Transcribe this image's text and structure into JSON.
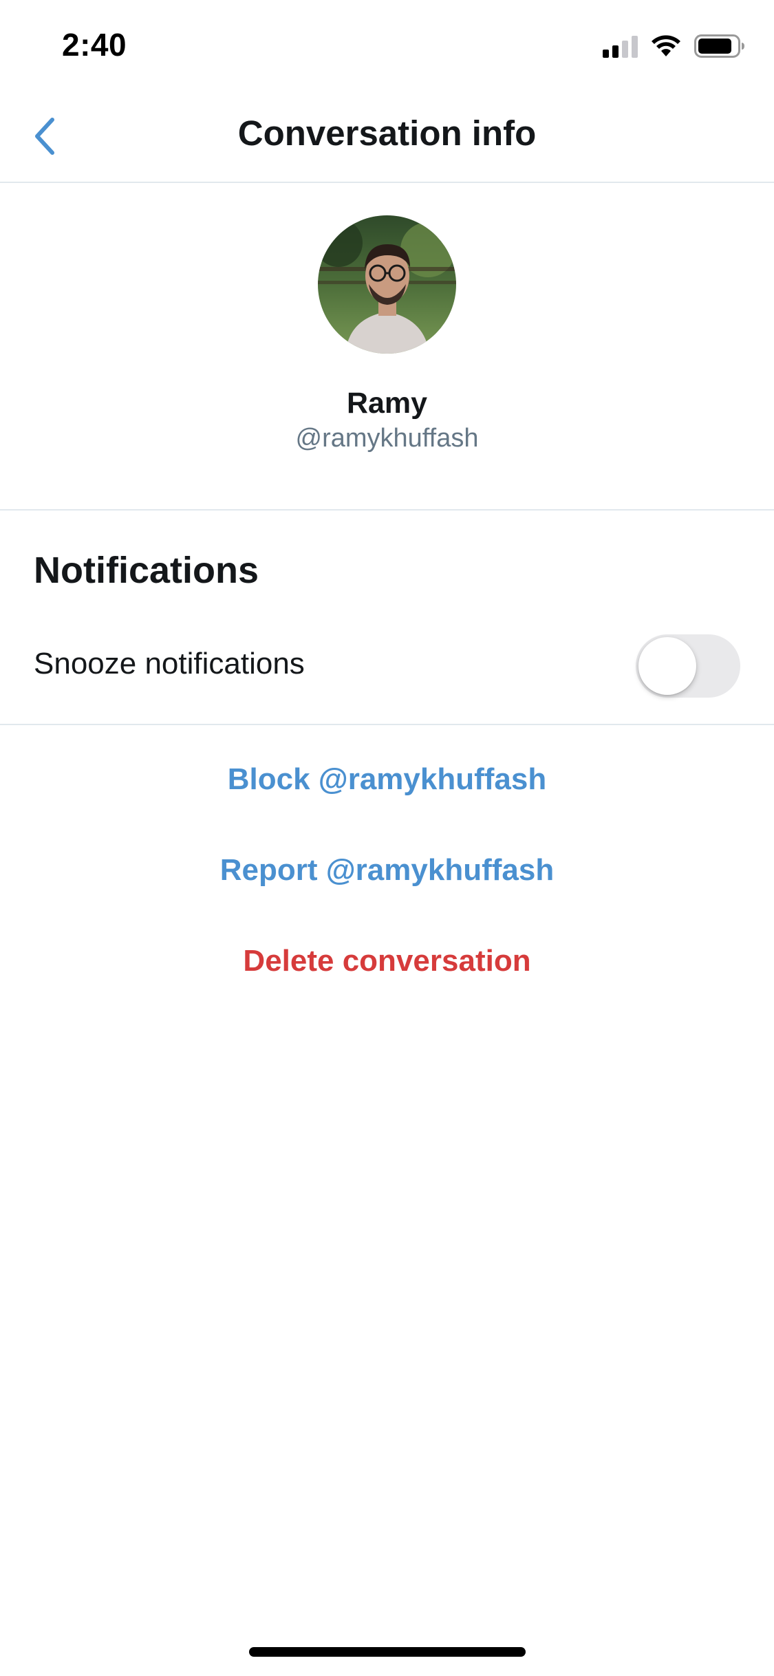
{
  "status_bar": {
    "time": "2:40",
    "icons": [
      "signal-icon",
      "wifi-icon",
      "battery-icon"
    ]
  },
  "nav": {
    "back_icon": "chevron-left-icon",
    "title": "Conversation info"
  },
  "profile": {
    "avatar": "avatar-photo",
    "name": "Ramy",
    "handle": "@ramykhuffash"
  },
  "notifications": {
    "heading": "Notifications",
    "snooze_label": "Snooze notifications",
    "snooze_enabled": false
  },
  "actions": {
    "block": "Block @ramykhuffash",
    "report": "Report @ramykhuffash",
    "delete": "Delete conversation"
  },
  "colors": {
    "link_blue": "#4a90d0",
    "destructive_red": "#d63b3b",
    "divider": "#e1e8ed",
    "secondary_text": "#657786"
  }
}
